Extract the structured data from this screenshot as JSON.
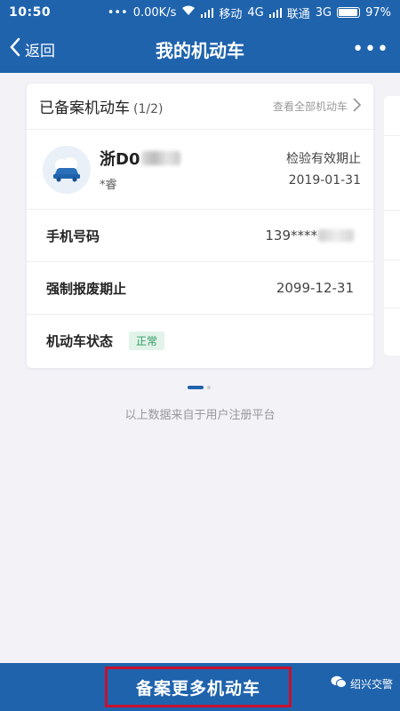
{
  "status_bar": {
    "time": "10:50",
    "speed": "0.00K/s",
    "carrier1": "移动",
    "net1": "4G",
    "carrier2": "联通",
    "net2": "3G",
    "battery": "97%"
  },
  "nav": {
    "back_label": "返回",
    "title": "我的机动车",
    "more_label": "•••"
  },
  "card": {
    "title": "已备案机动车",
    "count": "(1/2)",
    "view_all": "查看全部机动车",
    "plate": "浙D0",
    "owner": "*睿",
    "inspect_label": "检验有效期止",
    "inspect_date": "2019-01-31",
    "rows": [
      {
        "label": "手机号码",
        "value": "139****"
      },
      {
        "label": "强制报废期止",
        "value": "2099-12-31"
      },
      {
        "label": "机动车状态",
        "value": "正常"
      }
    ]
  },
  "source_note": "以上数据来自于用户注册平台",
  "bottom": {
    "register_label": "备案更多机动车",
    "watermark": "绍兴交警"
  },
  "colors": {
    "primary": "#1f63ad",
    "highlight_border": "#c8102e",
    "status_green": "#2e9b5e"
  },
  "icons": {
    "back": "chevron-left-icon",
    "more": "more-dots-icon",
    "view_all": "chevron-right-icon",
    "vehicle": "car-icon",
    "watermark": "wechat-icon"
  }
}
